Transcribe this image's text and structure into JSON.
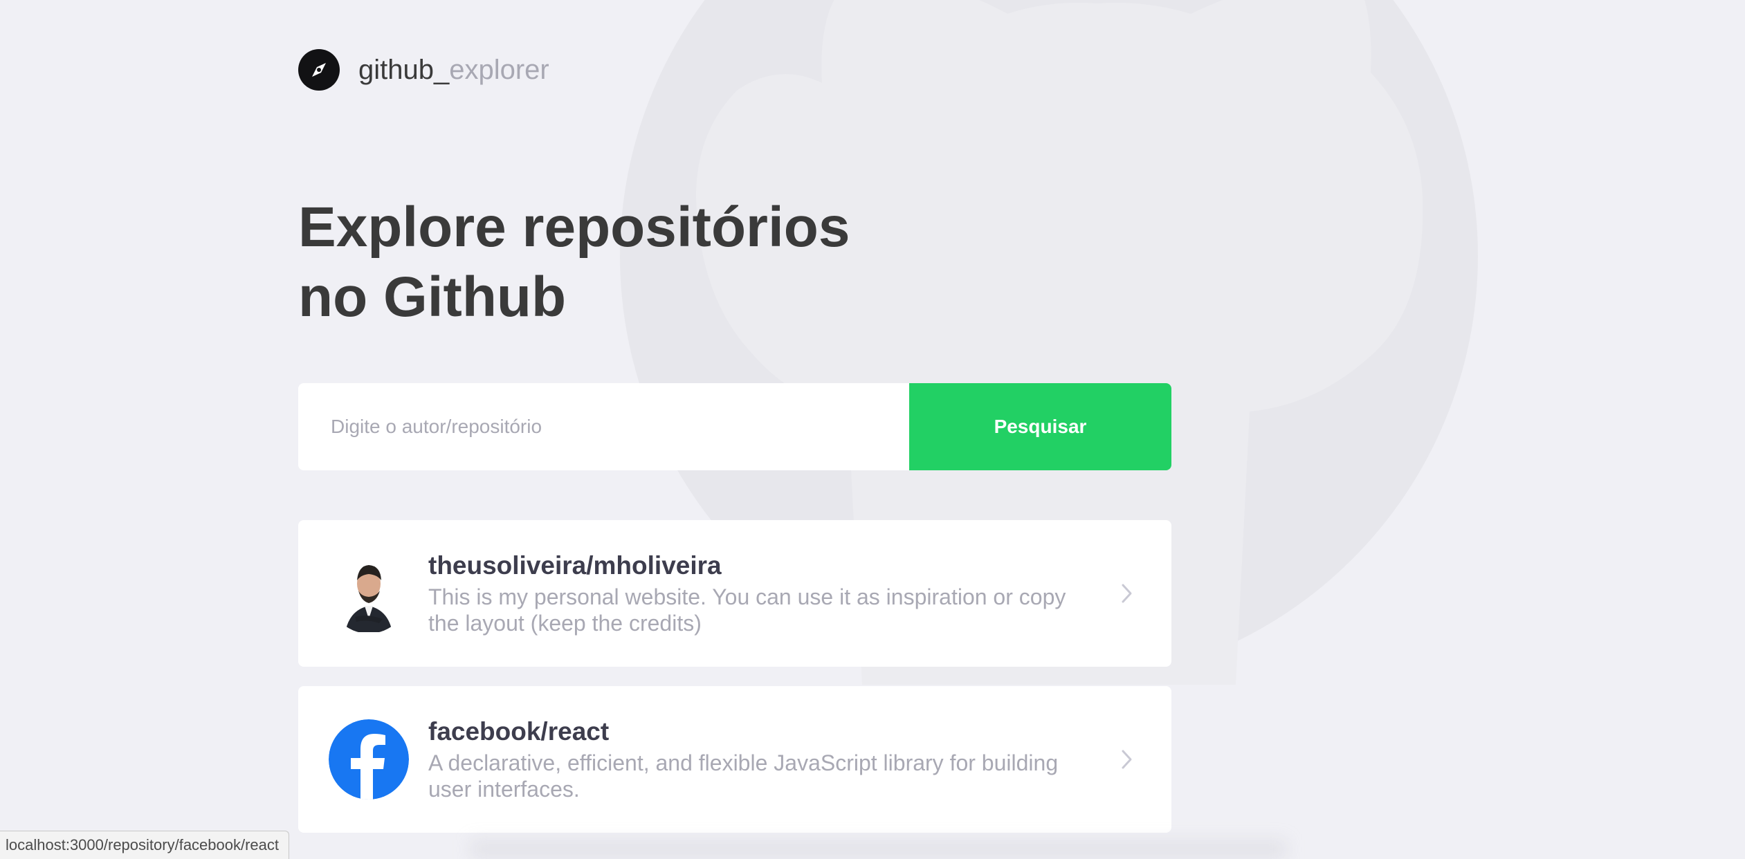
{
  "brand": {
    "name_prefix": "github_",
    "name_suffix": "explorer",
    "icon": "compass-icon"
  },
  "hero": {
    "line1": "Explore repositórios",
    "line2": "no Github"
  },
  "search": {
    "placeholder": "Digite o autor/repositório",
    "value": "",
    "button_label": "Pesquisar"
  },
  "repositories": [
    {
      "title": "theusoliveira/mholiveira",
      "description": "This is my personal website. You can use it as inspiration or copy the layout (keep the credits)",
      "avatar": "person-avatar-icon",
      "action_icon": "chevron-right-icon"
    },
    {
      "title": "facebook/react",
      "description": "A declarative, efficient, and flexible JavaScript library for building user interfaces.",
      "avatar": "facebook-logo-icon",
      "action_icon": "chevron-right-icon"
    }
  ],
  "statusbar": {
    "url": "localhost:3000/repository/facebook/react"
  },
  "colors": {
    "background": "#f0f0f5",
    "text_primary": "#3a3a3a",
    "text_muted": "#a8a8b3",
    "accent": "#22d064",
    "facebook_blue": "#1877f2"
  }
}
